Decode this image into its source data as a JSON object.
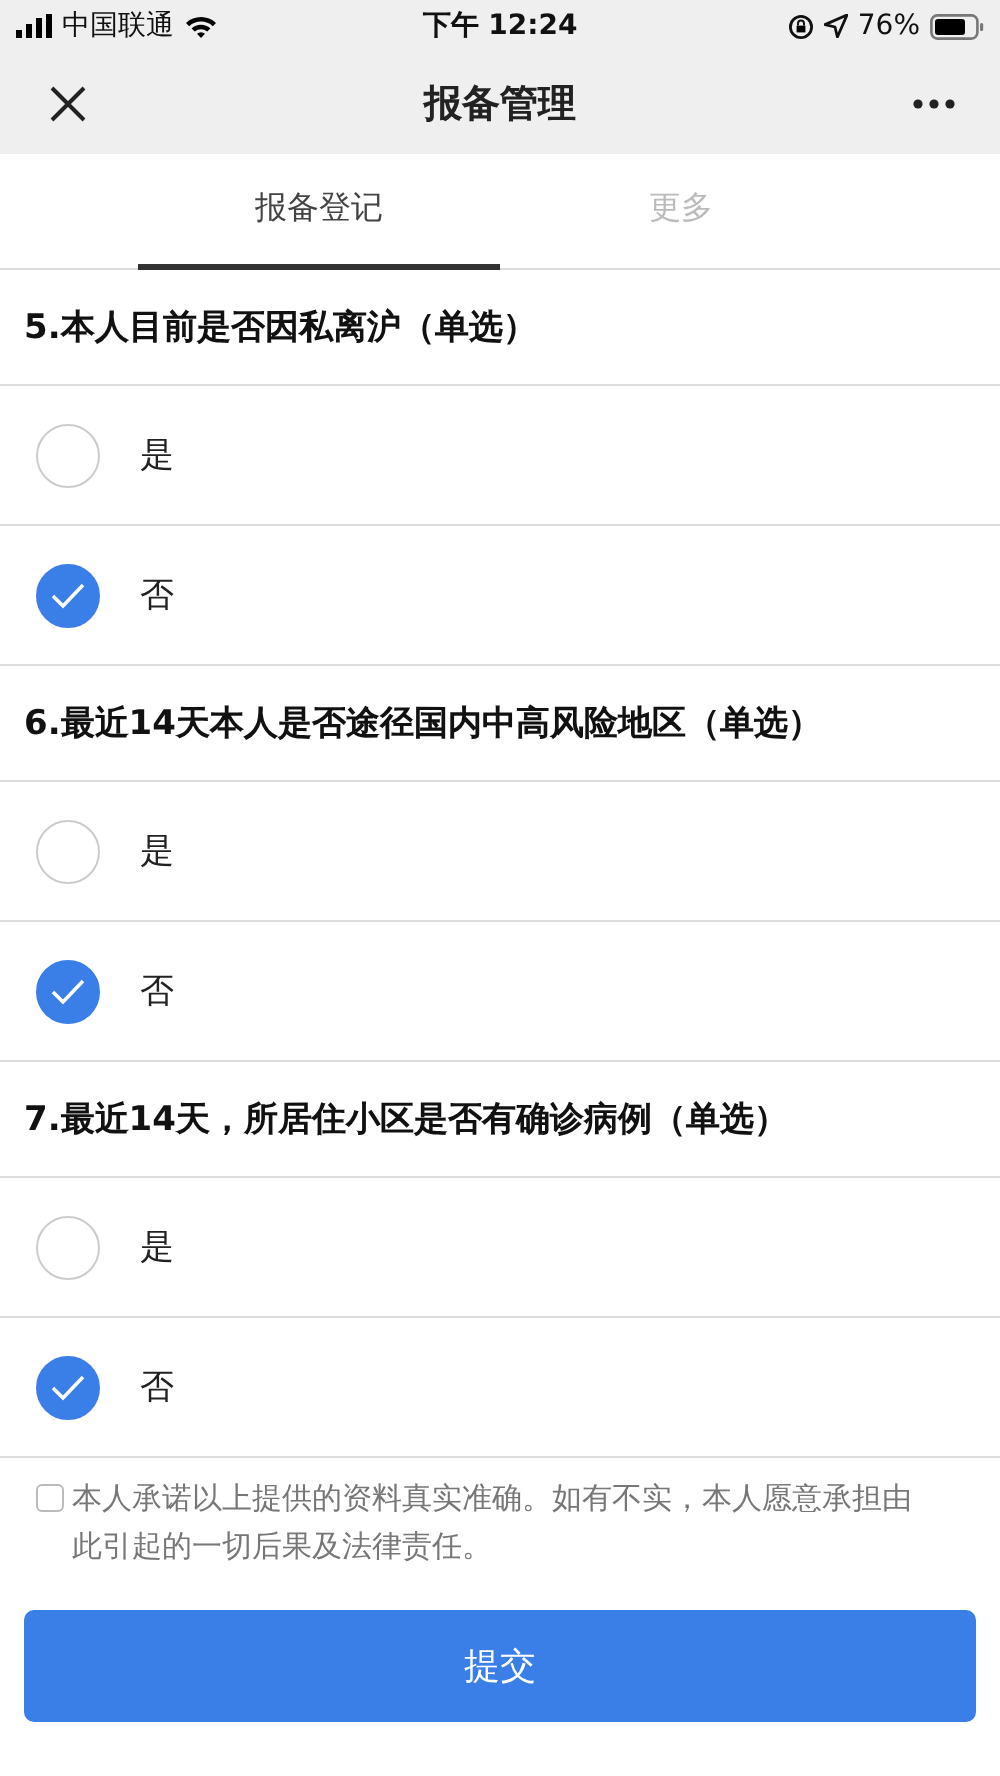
{
  "status_bar": {
    "carrier": "中国联通",
    "time": "下午 12:24",
    "battery": "76%"
  },
  "nav": {
    "title": "报备管理"
  },
  "tabs": [
    {
      "label": "报备登记",
      "selected": true
    },
    {
      "label": "更多",
      "selected": false
    }
  ],
  "questions": [
    {
      "title": "5.本人目前是否因私离沪（单选）",
      "options": [
        {
          "label": "是",
          "selected": false
        },
        {
          "label": "否",
          "selected": true
        }
      ]
    },
    {
      "title": "6.最近14天本人是否途径国内中高风险地区（单选）",
      "options": [
        {
          "label": "是",
          "selected": false
        },
        {
          "label": "否",
          "selected": true
        }
      ]
    },
    {
      "title": "7.最近14天，所居住小区是否有确诊病例（单选）",
      "options": [
        {
          "label": "是",
          "selected": false
        },
        {
          "label": "否",
          "selected": true
        }
      ]
    }
  ],
  "agreement": {
    "text": "本人承诺以上提供的资料真实准确。如有不实，本人愿意承担由此引起的一切后果及法律责任。",
    "checked": false
  },
  "submit": "提交"
}
